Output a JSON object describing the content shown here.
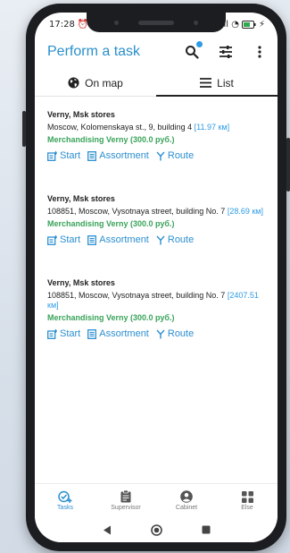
{
  "status_bar": {
    "time": "17:28",
    "left_extra": "⏰ ▣",
    "right_extra": "ll ◔",
    "battery_suffix": "⚡"
  },
  "app_bar": {
    "title": "Perform a task"
  },
  "tabs": [
    {
      "label": "On map",
      "icon": "globe-icon",
      "active": false
    },
    {
      "label": "List",
      "icon": "list-icon",
      "active": true
    }
  ],
  "cards": [
    {
      "name": "Verny, Msk stores",
      "address": "Moscow, Kolomenskaya st., 9, building 4",
      "distance": "[11.97 км]",
      "task": "Merchandising Verny (300.0 руб.)"
    },
    {
      "name": "Verny, Msk stores",
      "address": "108851, Moscow, Vysotnaya street, building No. 7",
      "distance": "[28.69 км]",
      "task": "Merchandising Verny (300.0 руб.)"
    },
    {
      "name": "Verny, Msk stores",
      "address": "108851, Moscow, Vysotnaya street, building No. 7",
      "distance": "[2407.51 км]",
      "task": "Merchandising Verny (300.0 руб.)"
    }
  ],
  "card_actions": {
    "start": "Start",
    "assortment": "Assortment",
    "route": "Route"
  },
  "bottom_nav": [
    {
      "label": "Tasks",
      "icon": "tasks-icon",
      "active": true
    },
    {
      "label": "Supervisor",
      "icon": "clipboard-icon",
      "active": false
    },
    {
      "label": "Cabinet",
      "icon": "person-icon",
      "active": false
    },
    {
      "label": "Else",
      "icon": "grid-icon",
      "active": false
    }
  ],
  "colors": {
    "accent": "#2d8fd0",
    "title": "#2a8fcb",
    "task_green": "#3aa35a",
    "distance": "#2d9be6"
  }
}
